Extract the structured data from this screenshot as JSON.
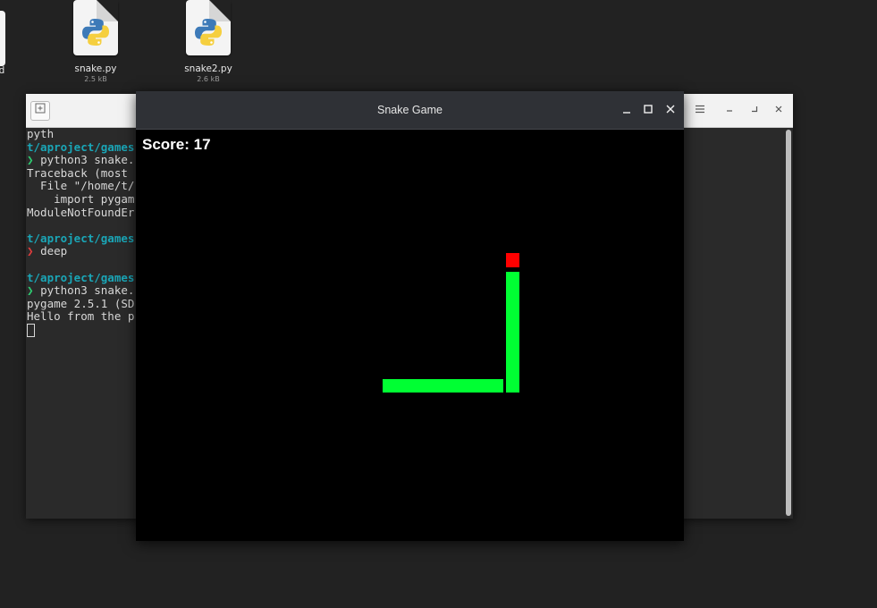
{
  "desktop": {
    "partial_label": "nd",
    "icons": [
      {
        "name": "snake.py",
        "size": "2.5 kB",
        "icon": "python-file-icon"
      },
      {
        "name": "snake2.py",
        "size": "2.6 kB",
        "icon": "python-file-icon"
      }
    ]
  },
  "terminal": {
    "new_tab_icon": "new-tab-icon",
    "lines": [
      [
        {
          "text": "pyth",
          "cls": ""
        }
      ],
      [
        {
          "text": "t/aproject/games",
          "cls": "c-path"
        }
      ],
      [
        {
          "text": "❯ ",
          "cls": "c-ok"
        },
        {
          "text": "python3 snake.",
          "cls": ""
        }
      ],
      [
        {
          "text": "Traceback (most",
          "cls": ""
        }
      ],
      [
        {
          "text": "  File \"/home/t/",
          "cls": ""
        }
      ],
      [
        {
          "text": "    import pygam",
          "cls": ""
        }
      ],
      [
        {
          "text": "ModuleNotFoundEr",
          "cls": ""
        }
      ],
      [
        {
          "text": "",
          "cls": ""
        }
      ],
      [
        {
          "text": "t/aproject/games",
          "cls": "c-path"
        }
      ],
      [
        {
          "text": "❯ ",
          "cls": "c-err"
        },
        {
          "text": "deep",
          "cls": ""
        }
      ],
      [
        {
          "text": "",
          "cls": ""
        }
      ],
      [
        {
          "text": "t/aproject/games",
          "cls": "c-path"
        }
      ],
      [
        {
          "text": "❯ ",
          "cls": "c-ok"
        },
        {
          "text": "python3 snake.",
          "cls": ""
        }
      ],
      [
        {
          "text": "pygame 2.5.1 (SD",
          "cls": ""
        }
      ],
      [
        {
          "text": "Hello from the p",
          "cls": ""
        }
      ]
    ]
  },
  "game": {
    "title": "Snake Game",
    "score_label": "Score: 17",
    "colors": {
      "snake": "#00ff33",
      "food": "#ff0000",
      "background": "#000000"
    }
  }
}
